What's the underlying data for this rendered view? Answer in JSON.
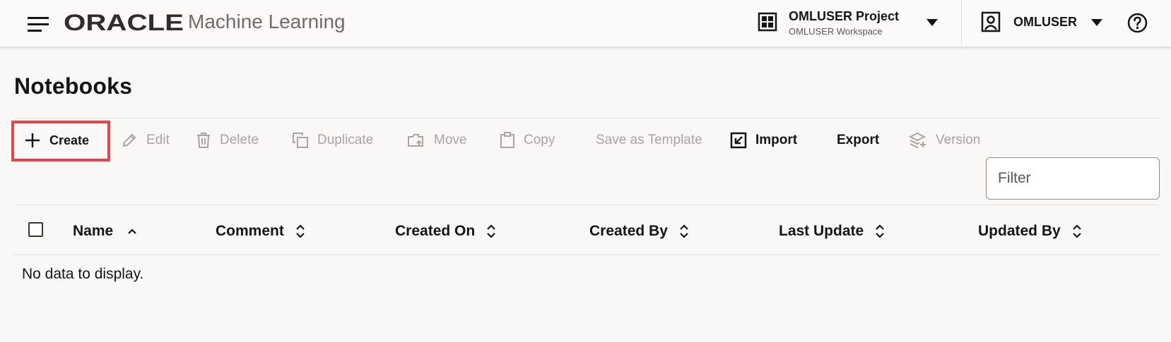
{
  "header": {
    "brand": "ORACLE",
    "app_name": "Machine Learning",
    "project_name": "OMLUSER Project",
    "workspace_name": "OMLUSER Workspace",
    "user_name": "OMLUSER",
    "icons": [
      "hamburger-icon",
      "oracle-logo",
      "project-grid-icon",
      "chevron-down-icon",
      "user-icon",
      "help-icon"
    ]
  },
  "page": {
    "title": "Notebooks"
  },
  "toolbar": {
    "create": "Create",
    "edit": "Edit",
    "delete": "Delete",
    "duplicate": "Duplicate",
    "move": "Move",
    "copy": "Copy",
    "save_template": "Save as Template",
    "import": "Import",
    "export": "Export",
    "version": "Version"
  },
  "filter": {
    "placeholder": "Filter",
    "value": ""
  },
  "table": {
    "columns": [
      "Name",
      "Comment",
      "Created On",
      "Created By",
      "Last Update",
      "Updated By"
    ],
    "sorted_column": "Name",
    "sort_direction": "ascending",
    "rows": [],
    "empty_message": "No data to display."
  },
  "colors": {
    "highlight": "#e8434a",
    "text": "#161513",
    "disabled_text": "#a8a4a0",
    "background": "#f9f8f6"
  }
}
